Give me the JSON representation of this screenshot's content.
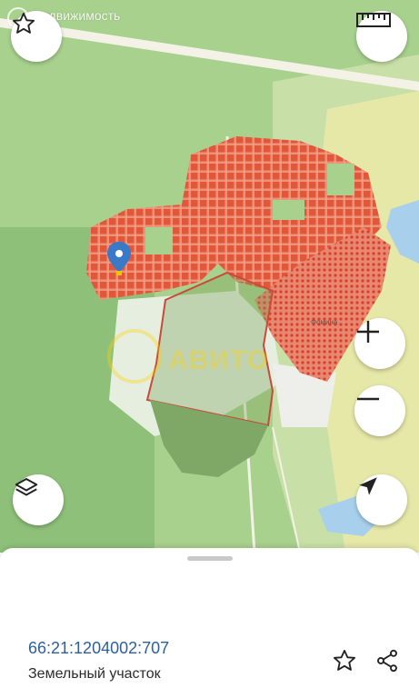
{
  "map": {
    "watermark_text": "Недвижимость",
    "center_watermark_text": "АВИТО",
    "place_label": "Фомина",
    "colors": {
      "forest": "#a9d18e",
      "forest_dark": "#8fc07a",
      "plots": "#e0583a",
      "field": "#e6eee0",
      "road": "#f4f1e6",
      "water": "#a8d0ec",
      "urban": "#e8e8a4",
      "pin": "#3a78c8"
    }
  },
  "controls": {
    "favorite_icon": "star-outline-icon",
    "ruler_icon": "ruler-icon",
    "zoom_in_icon": "plus-icon",
    "zoom_out_icon": "minus-icon",
    "layers_icon": "layers-icon",
    "locate_icon": "navigation-arrow-icon"
  },
  "sheet": {
    "cadastral_number": "66:21:1204002:707",
    "object_type": "Земельный участок",
    "favorite_icon": "star-outline-icon",
    "share_icon": "share-icon"
  }
}
